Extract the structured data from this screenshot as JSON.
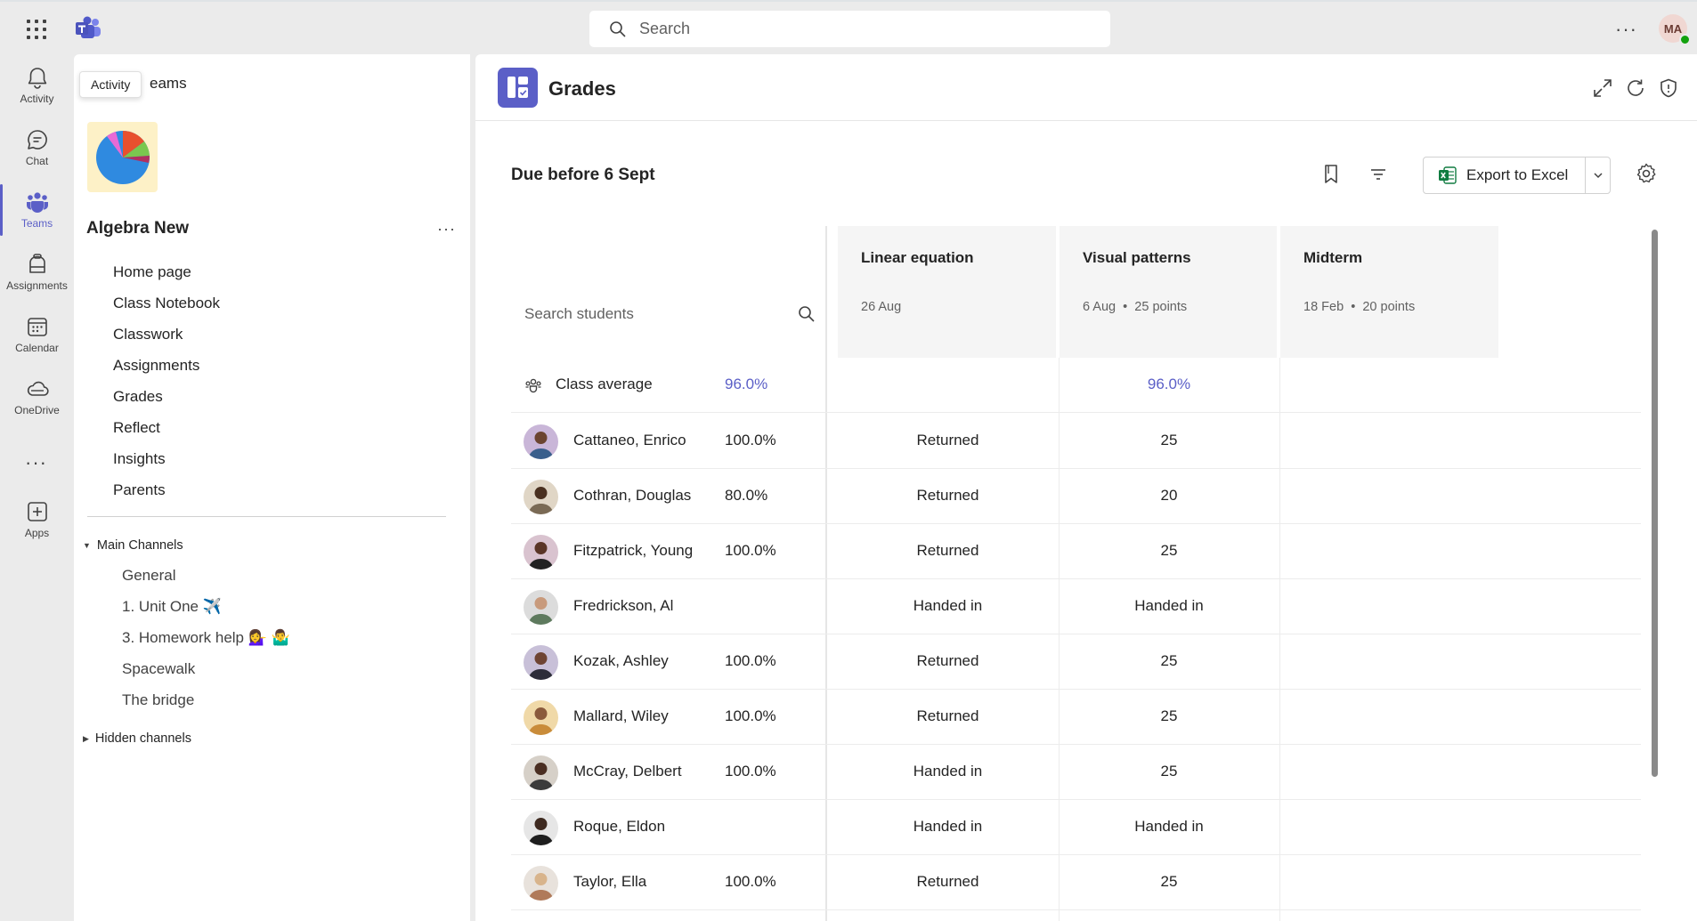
{
  "topbar": {
    "search_placeholder": "Search",
    "more_label": "···",
    "user_initials": "MA"
  },
  "tooltip": "Activity",
  "rail": {
    "items": [
      {
        "label": "Activity",
        "icon": "bell-icon"
      },
      {
        "label": "Chat",
        "icon": "chat-icon"
      },
      {
        "label": "Teams",
        "icon": "teams-icon"
      },
      {
        "label": "Assignments",
        "icon": "assignments-icon"
      },
      {
        "label": "Calendar",
        "icon": "calendar-icon"
      },
      {
        "label": "OneDrive",
        "icon": "cloud-icon"
      },
      {
        "label": "Apps",
        "icon": "add-app-icon"
      }
    ],
    "more": "···"
  },
  "team_pane": {
    "header": "eams",
    "team_name": "Algebra New",
    "more": "···",
    "nav": [
      "Home page",
      "Class Notebook",
      "Classwork",
      "Assignments",
      "Grades",
      "Reflect",
      "Insights",
      "Parents"
    ],
    "main_channels_label": "Main Channels",
    "channels": [
      "General",
      "1. Unit One ✈️",
      "3. Homework help 💁‍♀️ 🤷‍♂️",
      "Spacewalk",
      "The bridge"
    ],
    "hidden_channels_label": "Hidden channels"
  },
  "main": {
    "title": "Grades",
    "due_label": "Due before 6 Sept",
    "export_label": "Export to Excel",
    "colors": {
      "accent": "#5b5fc7",
      "excel": "#107c41"
    }
  },
  "grid": {
    "search_placeholder": "Search students",
    "columns": [
      {
        "title": "Linear equation",
        "date": "26 Aug",
        "points": ""
      },
      {
        "title": "Visual patterns",
        "date": "6 Aug",
        "points": "25 points"
      },
      {
        "title": "Midterm",
        "date": "18 Feb",
        "points": "20 points"
      }
    ],
    "class_average": {
      "label": "Class average",
      "overall": "96.0%",
      "linear": "",
      "visual": "96.0%",
      "midterm": ""
    },
    "students": [
      {
        "name": "Cattaneo, Enrico",
        "avg": "100.0%",
        "linear": "Returned",
        "visual": "25",
        "midterm": ""
      },
      {
        "name": "Cothran, Douglas",
        "avg": "80.0%",
        "linear": "Returned",
        "visual": "20",
        "midterm": ""
      },
      {
        "name": "Fitzpatrick, Young",
        "avg": "100.0%",
        "linear": "Returned",
        "visual": "25",
        "midterm": ""
      },
      {
        "name": "Fredrickson, Al",
        "avg": "",
        "linear": "Handed in",
        "visual": "Handed in",
        "midterm": ""
      },
      {
        "name": "Kozak, Ashley",
        "avg": "100.0%",
        "linear": "Returned",
        "visual": "25",
        "midterm": ""
      },
      {
        "name": "Mallard, Wiley",
        "avg": "100.0%",
        "linear": "Returned",
        "visual": "25",
        "midterm": ""
      },
      {
        "name": "McCray, Delbert",
        "avg": "100.0%",
        "linear": "Handed in",
        "visual": "25",
        "midterm": ""
      },
      {
        "name": "Roque, Eldon",
        "avg": "",
        "linear": "Handed in",
        "visual": "Handed in",
        "midterm": ""
      },
      {
        "name": "Taylor, Ella",
        "avg": "100.0%",
        "linear": "Returned",
        "visual": "25",
        "midterm": ""
      }
    ]
  }
}
